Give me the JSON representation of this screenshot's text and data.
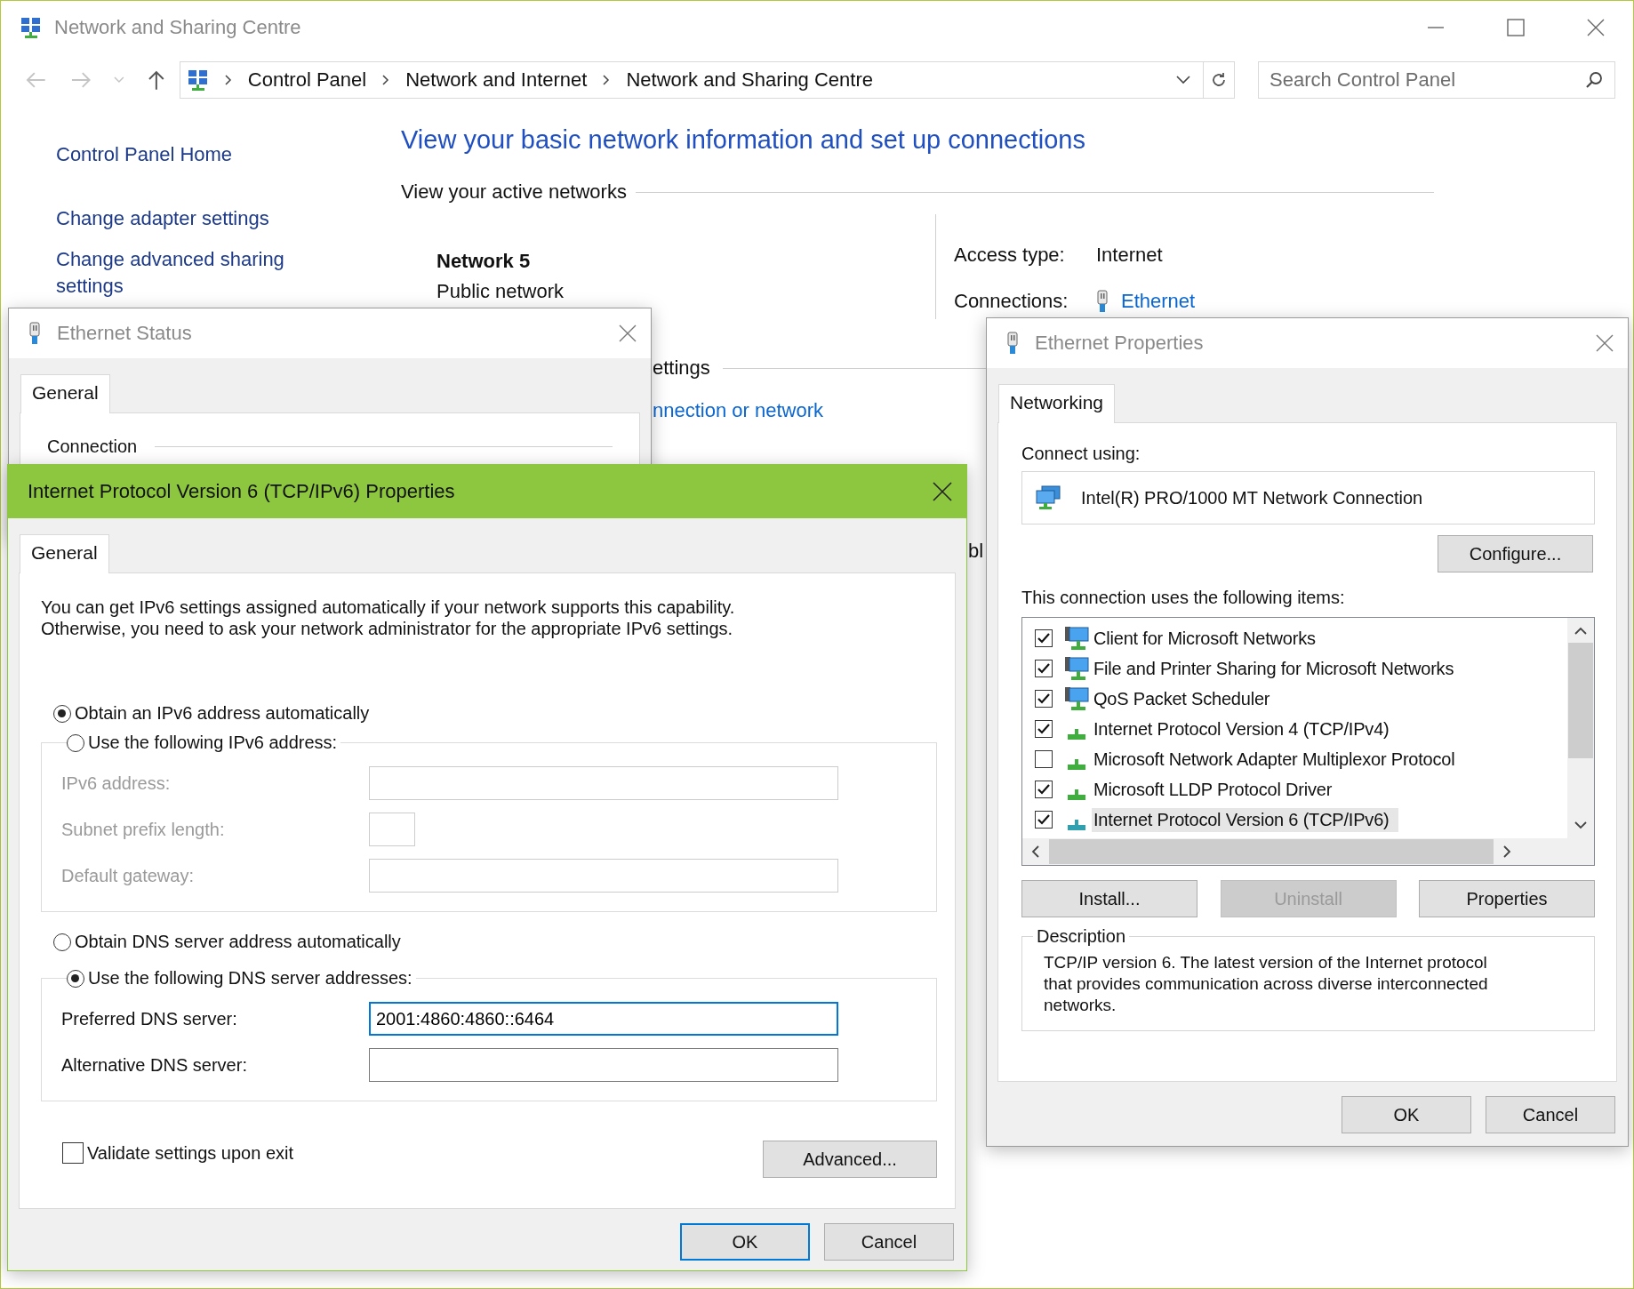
{
  "window": {
    "title": "Network and Sharing Centre",
    "active": false
  },
  "address_bar": {
    "breadcrumbs": [
      "Control Panel",
      "Network and Internet",
      "Network and Sharing Centre"
    ]
  },
  "search": {
    "placeholder": "Search Control Panel"
  },
  "sidebar": {
    "links": [
      "Control Panel Home",
      "Change adapter settings",
      "Change advanced sharing settings"
    ]
  },
  "main": {
    "heading": "View your basic network information and set up connections",
    "active_networks_label": "View your active networks",
    "network_name": "Network 5",
    "network_type": "Public network",
    "access_type_label": "Access type:",
    "access_type": "Internet",
    "connections_label": "Connections:",
    "connection_link": "Ethernet",
    "settings_fragment": "ettings",
    "link_fragment": "nnection or network",
    "text_fragment": "bl"
  },
  "ethernet_status": {
    "title": "Ethernet Status",
    "active": false,
    "tabs": [
      {
        "label": "General",
        "selected": true
      }
    ],
    "section_label": "Connection"
  },
  "ipv6_dialog": {
    "title": "Internet Protocol Version 6 (TCP/IPv6) Properties",
    "active": true,
    "tabs": [
      {
        "label": "General",
        "selected": true
      }
    ],
    "intro": "You can get IPv6 settings assigned automatically if your network supports this capability.\nOtherwise, you need to ask your network administrator for the appropriate IPv6 settings.",
    "address_options": [
      {
        "label": "Obtain an IPv6 address automatically",
        "selected": true
      },
      {
        "label": "Use the following IPv6 address:",
        "selected": false
      }
    ],
    "address_fields": [
      {
        "label": "IPv6 address:",
        "kind": "wide",
        "disabled": true
      },
      {
        "label": "Subnet prefix length:",
        "kind": "short",
        "disabled": true
      },
      {
        "label": "Default gateway:",
        "kind": "wide",
        "disabled": true
      }
    ],
    "dns_options": [
      {
        "label": "Obtain DNS server address automatically",
        "selected": false
      },
      {
        "label": "Use the following DNS server addresses:",
        "selected": true
      }
    ],
    "dns_fields": [
      {
        "label": "Preferred DNS server:",
        "kind": "wide",
        "value": "2001:4860:4860::6464",
        "focused": true,
        "disabled": false
      },
      {
        "label": "Alternative DNS server:",
        "kind": "wide",
        "focused": false,
        "disabled": false
      }
    ],
    "validate": {
      "label": "Validate settings upon exit",
      "checked": false
    },
    "advanced_button": "Advanced...",
    "buttons": [
      {
        "label": "OK",
        "default": true
      },
      {
        "label": "Cancel",
        "default": false
      }
    ]
  },
  "ethernet_properties": {
    "title": "Ethernet Properties",
    "active": false,
    "tabs": [
      {
        "label": "Networking",
        "selected": true
      }
    ],
    "connect_using_label": "Connect using:",
    "adapter": "Intel(R) PRO/1000 MT Network Connection",
    "configure_button": "Configure...",
    "items_label": "This connection uses the following items:",
    "items": [
      {
        "label": "Client for Microsoft Networks",
        "kind": "service",
        "checked": true,
        "selected": false
      },
      {
        "label": "File and Printer Sharing for Microsoft Networks",
        "kind": "service",
        "checked": true,
        "selected": false
      },
      {
        "label": "QoS Packet Scheduler",
        "kind": "service",
        "checked": true,
        "selected": false
      },
      {
        "label": "Internet Protocol Version 4 (TCP/IPv4)",
        "kind": "protocol",
        "checked": true,
        "selected": false
      },
      {
        "label": "Microsoft Network Adapter Multiplexor Protocol",
        "kind": "protocol",
        "checked": false,
        "selected": false
      },
      {
        "label": "Microsoft LLDP Protocol Driver",
        "kind": "protocol",
        "checked": true,
        "selected": false
      },
      {
        "label": "Internet Protocol Version 6 (TCP/IPv6)",
        "kind": "protocol",
        "checked": true,
        "selected": true
      }
    ],
    "buttons": [
      {
        "label": "Install...",
        "disabled": false
      },
      {
        "label": "Uninstall",
        "disabled": true
      },
      {
        "label": "Properties",
        "disabled": false
      }
    ],
    "description_label": "Description",
    "description": "TCP/IP version 6. The latest version of the Internet protocol\nthat provides communication across diverse interconnected\nnetworks.",
    "dialog_buttons": [
      {
        "label": "OK",
        "default": false
      },
      {
        "label": "Cancel",
        "default": false
      }
    ]
  }
}
